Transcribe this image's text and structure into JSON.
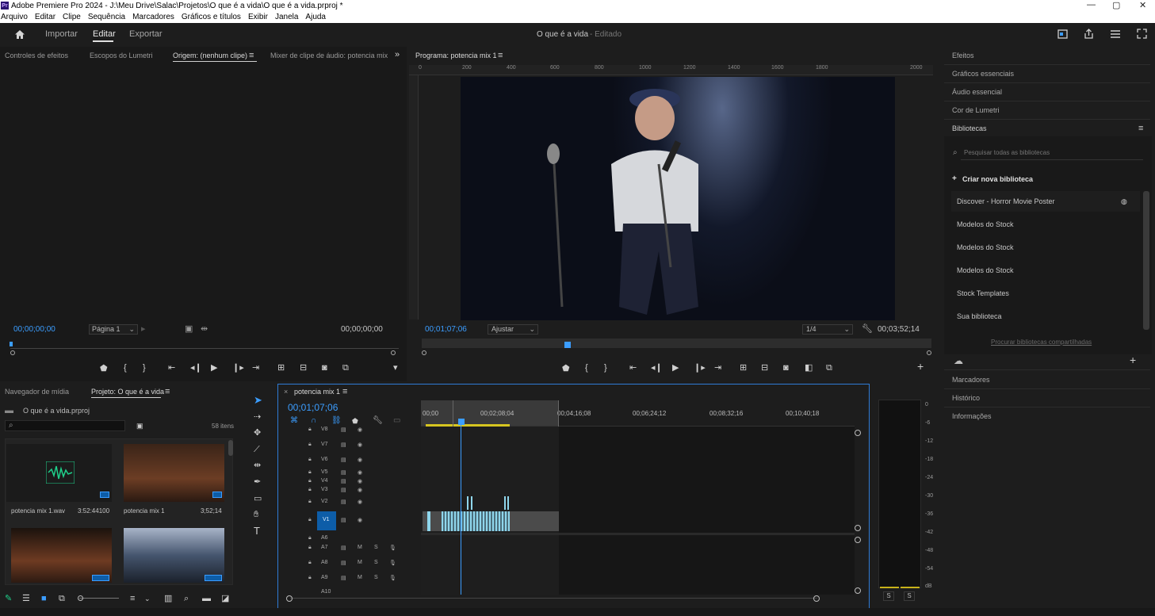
{
  "window": {
    "app_badge": "Pr",
    "title": "Adobe Premiere Pro 2024 - J:\\Meu Drive\\Salac\\Projetos\\O que é a vida\\O que é a vida.prproj *",
    "minimize": "—",
    "maximize": "▢",
    "close": "✕"
  },
  "menu": [
    "Arquivo",
    "Editar",
    "Clipe",
    "Sequência",
    "Marcadores",
    "Gráficos e títulos",
    "Exibir",
    "Janela",
    "Ajuda"
  ],
  "header": {
    "importar": "Importar",
    "editar": "Editar",
    "exportar": "Exportar",
    "project_title": "O que é a vida",
    "status": "- Editado"
  },
  "source_panel": {
    "tabs": [
      "Controles de efeitos",
      "Escopos do Lumetri",
      "Origem: (nenhum clipe)",
      "Mixer de clipe de áudio: potencia mix"
    ],
    "timecode_left": "00;00;00;00",
    "page_select": "Página 1",
    "timecode_right": "00;00;00;00"
  },
  "program_panel": {
    "tab": "Programa: potencia mix 1",
    "ruler_ticks": [
      "0",
      "200",
      "400",
      "600",
      "800",
      "1000",
      "1200",
      "1400",
      "1600",
      "1800",
      "2000"
    ],
    "timecode": "00;01;07;06",
    "fit_select": "Ajustar",
    "resolution": "1/4",
    "duration": "00;03;52;14"
  },
  "right_panel": {
    "effects": "Efeitos",
    "essential_graphics": "Gráficos essenciais",
    "essential_audio": "Áudio essencial",
    "lumetri_color": "Cor de Lumetri",
    "libraries": "Bibliotecas",
    "search_placeholder": "Pesquisar todas as bibliotecas",
    "create_library": "Criar nova biblioteca",
    "libraries_list": [
      "Discover - Horror Movie Poster",
      "Modelos do Stock",
      "Modelos do Stock",
      "Modelos do Stock",
      "Stock Templates",
      "Sua biblioteca"
    ],
    "shared_link": "Procurar bibliotecas compartilhadas",
    "markers": "Marcadores",
    "history": "Histórico",
    "info": "Informações"
  },
  "project_panel": {
    "tab_media": "Navegador de mídia",
    "tab_project": "Projeto: O que é a vida",
    "file": "O que é a vida.prproj",
    "count": "58 itens",
    "items": [
      {
        "name": "potencia mix 1.wav",
        "duration": "3:52:44100"
      },
      {
        "name": "potencia mix 1",
        "duration": "3;52;14"
      }
    ]
  },
  "timeline": {
    "tab": "potencia mix 1",
    "timecode": "00;01;07;06",
    "ruler": [
      "00;00",
      "00;02;08;04",
      "00;04;16;08",
      "00;06;24;12",
      "00;08;32;16",
      "00;10;40;18"
    ],
    "video_tracks": [
      "V8",
      "V7",
      "V6",
      "V5",
      "V4",
      "V3",
      "V2",
      "V1"
    ],
    "audio_tracks": [
      "A6",
      "A7",
      "A8",
      "A9",
      "A10"
    ],
    "mute_label": "M",
    "solo_label": "S"
  },
  "meter": {
    "labels": [
      "0",
      "-6",
      "-12",
      "-18",
      "-24",
      "-30",
      "-36",
      "-42",
      "-48",
      "-54",
      "dB"
    ],
    "solo_left": "S",
    "solo_right": "S"
  },
  "colors": {
    "accent_blue": "#3b9dff",
    "panel_bg": "#1d1d1d",
    "clip_blue": "#8fd6ec",
    "selected_track": "#0d5da8",
    "waveform_green": "#1fd18b"
  }
}
